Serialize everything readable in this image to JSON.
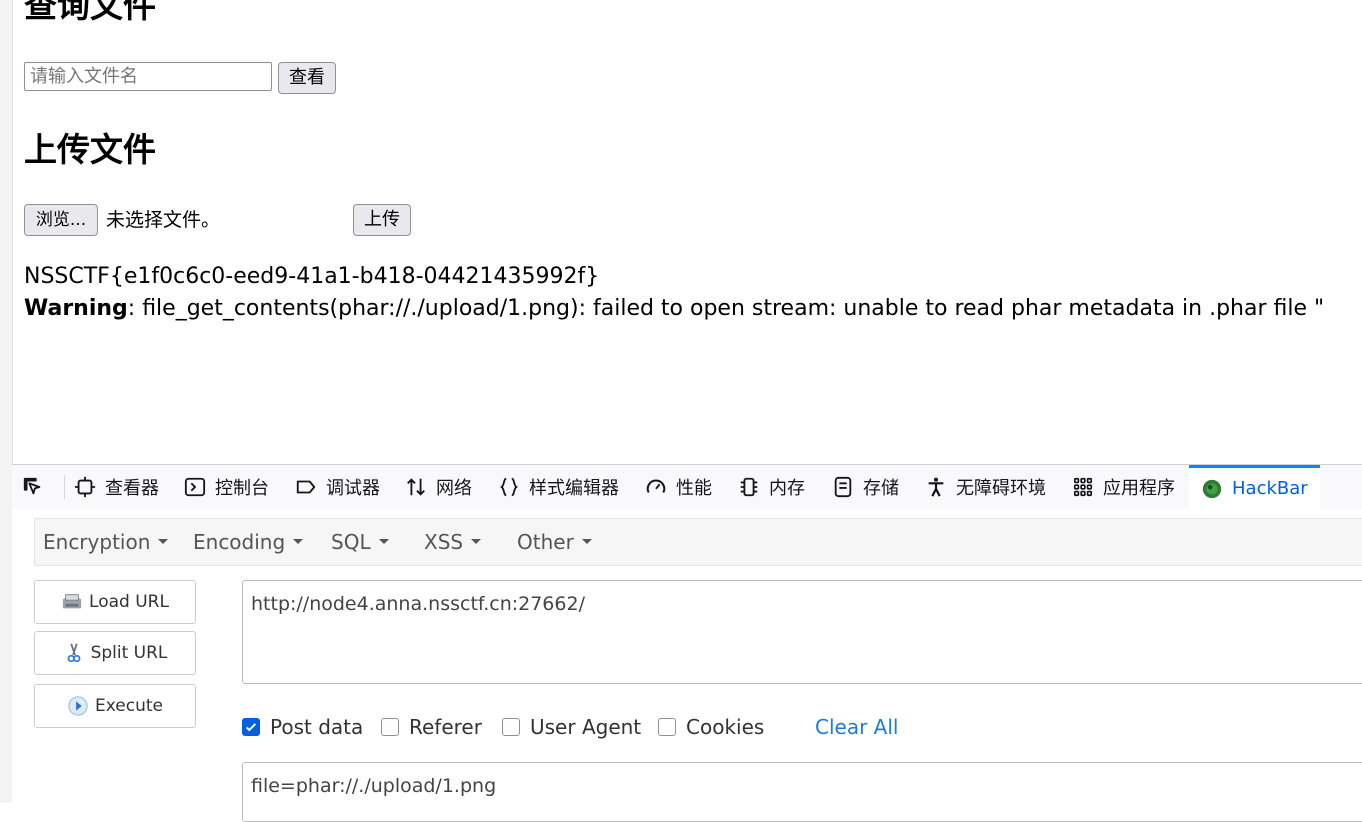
{
  "page": {
    "query_heading": "查询文件",
    "query_placeholder": "请输入文件名",
    "query_button": "查看",
    "upload_heading": "上传文件",
    "browse_button": "浏览...",
    "no_file_text": "未选择文件。",
    "upload_button": "上传",
    "flag_text": "NSSCTF{e1f0c6c0-eed9-41a1-b418-04421435992f}",
    "warning_label": "Warning",
    "warning_message": ": file_get_contents(phar://./upload/1.png): failed to open stream: unable to read phar metadata in .phar file \""
  },
  "devtools": {
    "tabs": [
      {
        "label": "查看器",
        "icon": "inspector-icon"
      },
      {
        "label": "控制台",
        "icon": "console-icon"
      },
      {
        "label": "调试器",
        "icon": "debugger-icon"
      },
      {
        "label": "网络",
        "icon": "network-icon"
      },
      {
        "label": "样式编辑器",
        "icon": "style-editor-icon"
      },
      {
        "label": "性能",
        "icon": "performance-icon"
      },
      {
        "label": "内存",
        "icon": "memory-icon"
      },
      {
        "label": "存储",
        "icon": "storage-icon"
      },
      {
        "label": "无障碍环境",
        "icon": "accessibility-icon"
      },
      {
        "label": "应用程序",
        "icon": "application-icon"
      },
      {
        "label": "HackBar",
        "icon": "hackbar-icon"
      }
    ],
    "active_tab": "HackBar"
  },
  "hackbar": {
    "menus": [
      "Encryption",
      "Encoding",
      "SQL",
      "XSS",
      "Other"
    ],
    "load_url": "Load URL",
    "split_url": "Split URL",
    "execute": "Execute",
    "url_value": "http://node4.anna.nssctf.cn:27662/",
    "options": [
      {
        "label": "Post data",
        "checked": true
      },
      {
        "label": "Referer",
        "checked": false
      },
      {
        "label": "User Agent",
        "checked": false
      },
      {
        "label": "Cookies",
        "checked": false
      }
    ],
    "clear_all": "Clear All",
    "post_value": "file=phar://./upload/1.png"
  },
  "colors": {
    "accent": "#0a84ff",
    "active_tab_text": "#0060df",
    "link": "#1e7bd6"
  }
}
